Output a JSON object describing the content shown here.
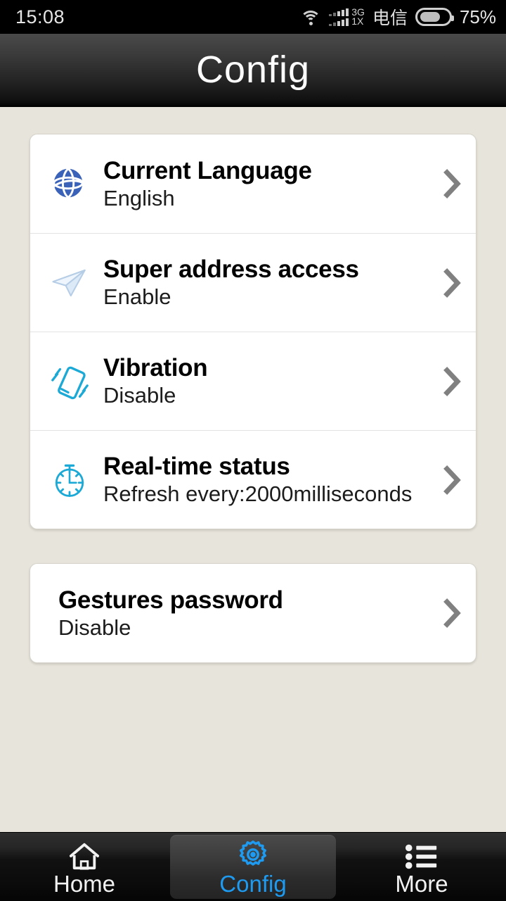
{
  "status_bar": {
    "time": "15:08",
    "wifi_icon": "wifi-icon",
    "signal_3g_label": "3G",
    "signal_1x_label": "1X",
    "carrier": "电信",
    "battery_icon": "battery-icon",
    "battery_percent": "75%",
    "battery_level": 75
  },
  "header": {
    "title": "Config"
  },
  "colors": {
    "page_background": "#e7e4db",
    "card_background": "#ffffff",
    "accent_blue": "#1e9bf0",
    "icon_cyan": "#1ca9d6",
    "icon_globe_blue": "#3a62b8",
    "chevron_gray": "#808080"
  },
  "main": {
    "groups": [
      {
        "rows": [
          {
            "icon": "globe-icon",
            "title": "Current Language",
            "value": "English",
            "chevron": "chevron-right-icon"
          },
          {
            "icon": "paper-plane-icon",
            "title": "Super address access",
            "value": "Enable",
            "chevron": "chevron-right-icon"
          },
          {
            "icon": "vibration-icon",
            "title": "Vibration",
            "value": "Disable",
            "chevron": "chevron-right-icon"
          },
          {
            "icon": "stopwatch-icon",
            "title": "Real-time status",
            "value": "Refresh every:2000milliseconds",
            "chevron": "chevron-right-icon"
          }
        ]
      },
      {
        "rows": [
          {
            "icon": "",
            "title": "Gestures password",
            "value": "Disable",
            "chevron": "chevron-right-icon"
          }
        ]
      }
    ]
  },
  "bottom_nav": {
    "items": [
      {
        "icon": "home-icon",
        "label": "Home",
        "selected": false
      },
      {
        "icon": "gear-icon",
        "label": "Config",
        "selected": true
      },
      {
        "icon": "list-icon",
        "label": "More",
        "selected": false
      }
    ]
  }
}
